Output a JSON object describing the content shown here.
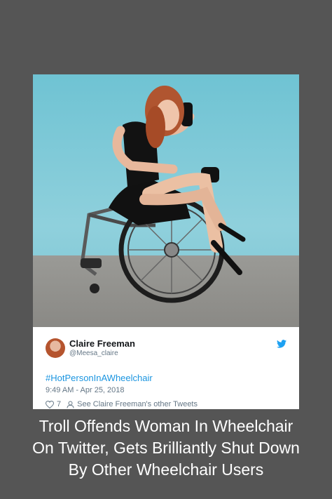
{
  "tweet": {
    "name": "Claire Freeman",
    "handle": "@Meesa_claire",
    "hashtag": "#HotPersonInAWheelchair",
    "timestamp": "9:49 AM - Apr 25, 2018",
    "likes": "7",
    "other_tweets_link": "See Claire Freeman's other Tweets"
  },
  "icons": {
    "bird": "twitter-bird-icon",
    "heart": "heart-icon",
    "person": "person-icon"
  },
  "colors": {
    "background": "#555555",
    "link": "#1b95e0",
    "twitter_blue": "#1da1f2"
  },
  "caption": {
    "line1": "Troll Offends Woman In Wheelchair",
    "line2": "On Twitter, Gets Brilliantly Shut Down",
    "line3": "By Other Wheelchair Users"
  }
}
